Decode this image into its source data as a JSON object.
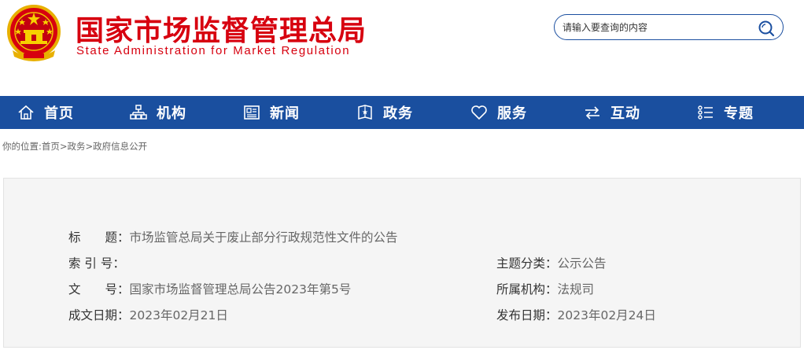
{
  "header": {
    "title_cn": "国家市场监督管理总局",
    "title_en": "State Administration for Market Regulation",
    "emblem": "national-emblem",
    "brand_color": "#d7000f"
  },
  "search": {
    "placeholder": "请输入要查询的内容",
    "icon": "search-icon"
  },
  "nav": {
    "color": "#1a4f9f",
    "items": [
      {
        "label": "首页",
        "icon": "home-icon"
      },
      {
        "label": "机构",
        "icon": "org-chart-icon"
      },
      {
        "label": "新闻",
        "icon": "newspaper-icon"
      },
      {
        "label": "政务",
        "icon": "document-badge-icon"
      },
      {
        "label": "服务",
        "icon": "heart-icon"
      },
      {
        "label": "互动",
        "icon": "exchange-arrows-icon"
      },
      {
        "label": "专题",
        "icon": "list-icon"
      }
    ]
  },
  "breadcrumb": {
    "prefix": "你的位置:",
    "items": [
      "首页",
      "政务",
      "政府信息公开"
    ],
    "separator": ">"
  },
  "doc_info": {
    "title_label": "标　　题：",
    "title_value": "市场监管总局关于废止部分行政规范性文件的公告",
    "index_label": "索 引 号：",
    "index_value": "",
    "topic_label": "主题分类：",
    "topic_value": "公示公告",
    "doc_no_label": "文　　号：",
    "doc_no_value": "国家市场监督管理总局公告2023年第5号",
    "dept_label": "所属机构：",
    "dept_value": "法规司",
    "created_label": "成文日期：",
    "created_value": "2023年02月21日",
    "published_label": "发布日期：",
    "published_value": "2023年02月24日"
  }
}
